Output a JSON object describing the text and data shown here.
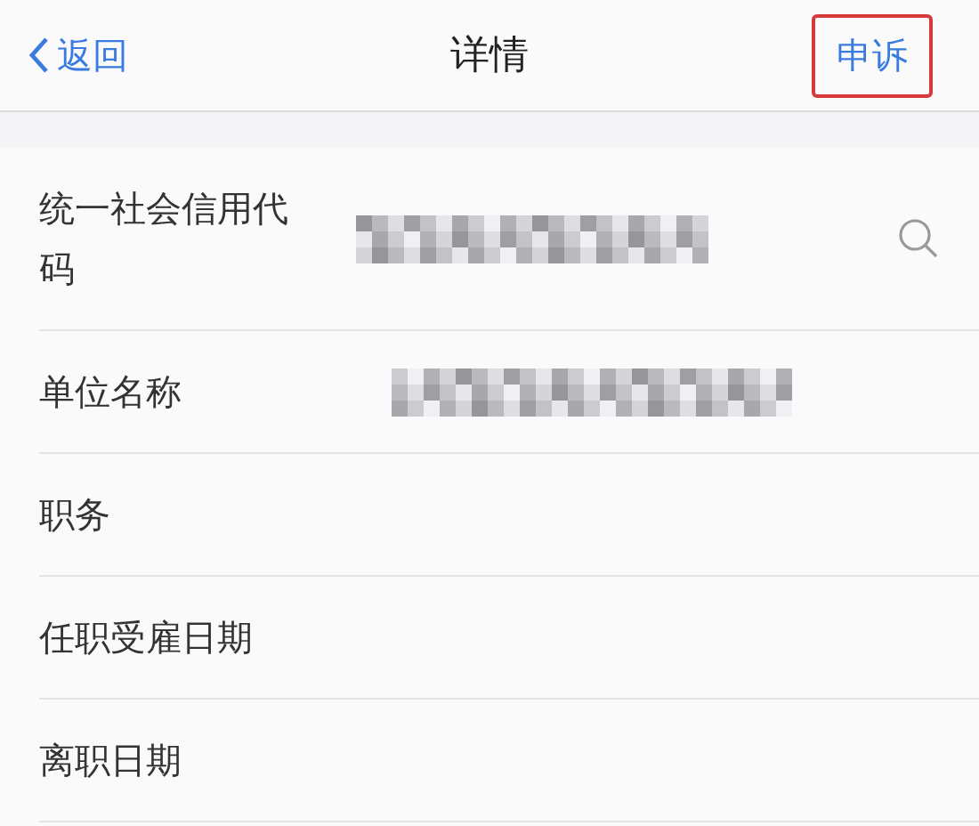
{
  "nav": {
    "back": "返回",
    "title": "详情",
    "action": {
      "label": "申诉",
      "highlighted": true
    }
  },
  "rows": [
    {
      "label": "统一社会信用代码",
      "kind": "masked_search"
    },
    {
      "label": "单位名称",
      "kind": "masked"
    },
    {
      "label": "职务",
      "kind": "empty"
    },
    {
      "label": "任职受雇日期",
      "kind": "empty"
    },
    {
      "label": "离职日期",
      "kind": "empty"
    }
  ]
}
